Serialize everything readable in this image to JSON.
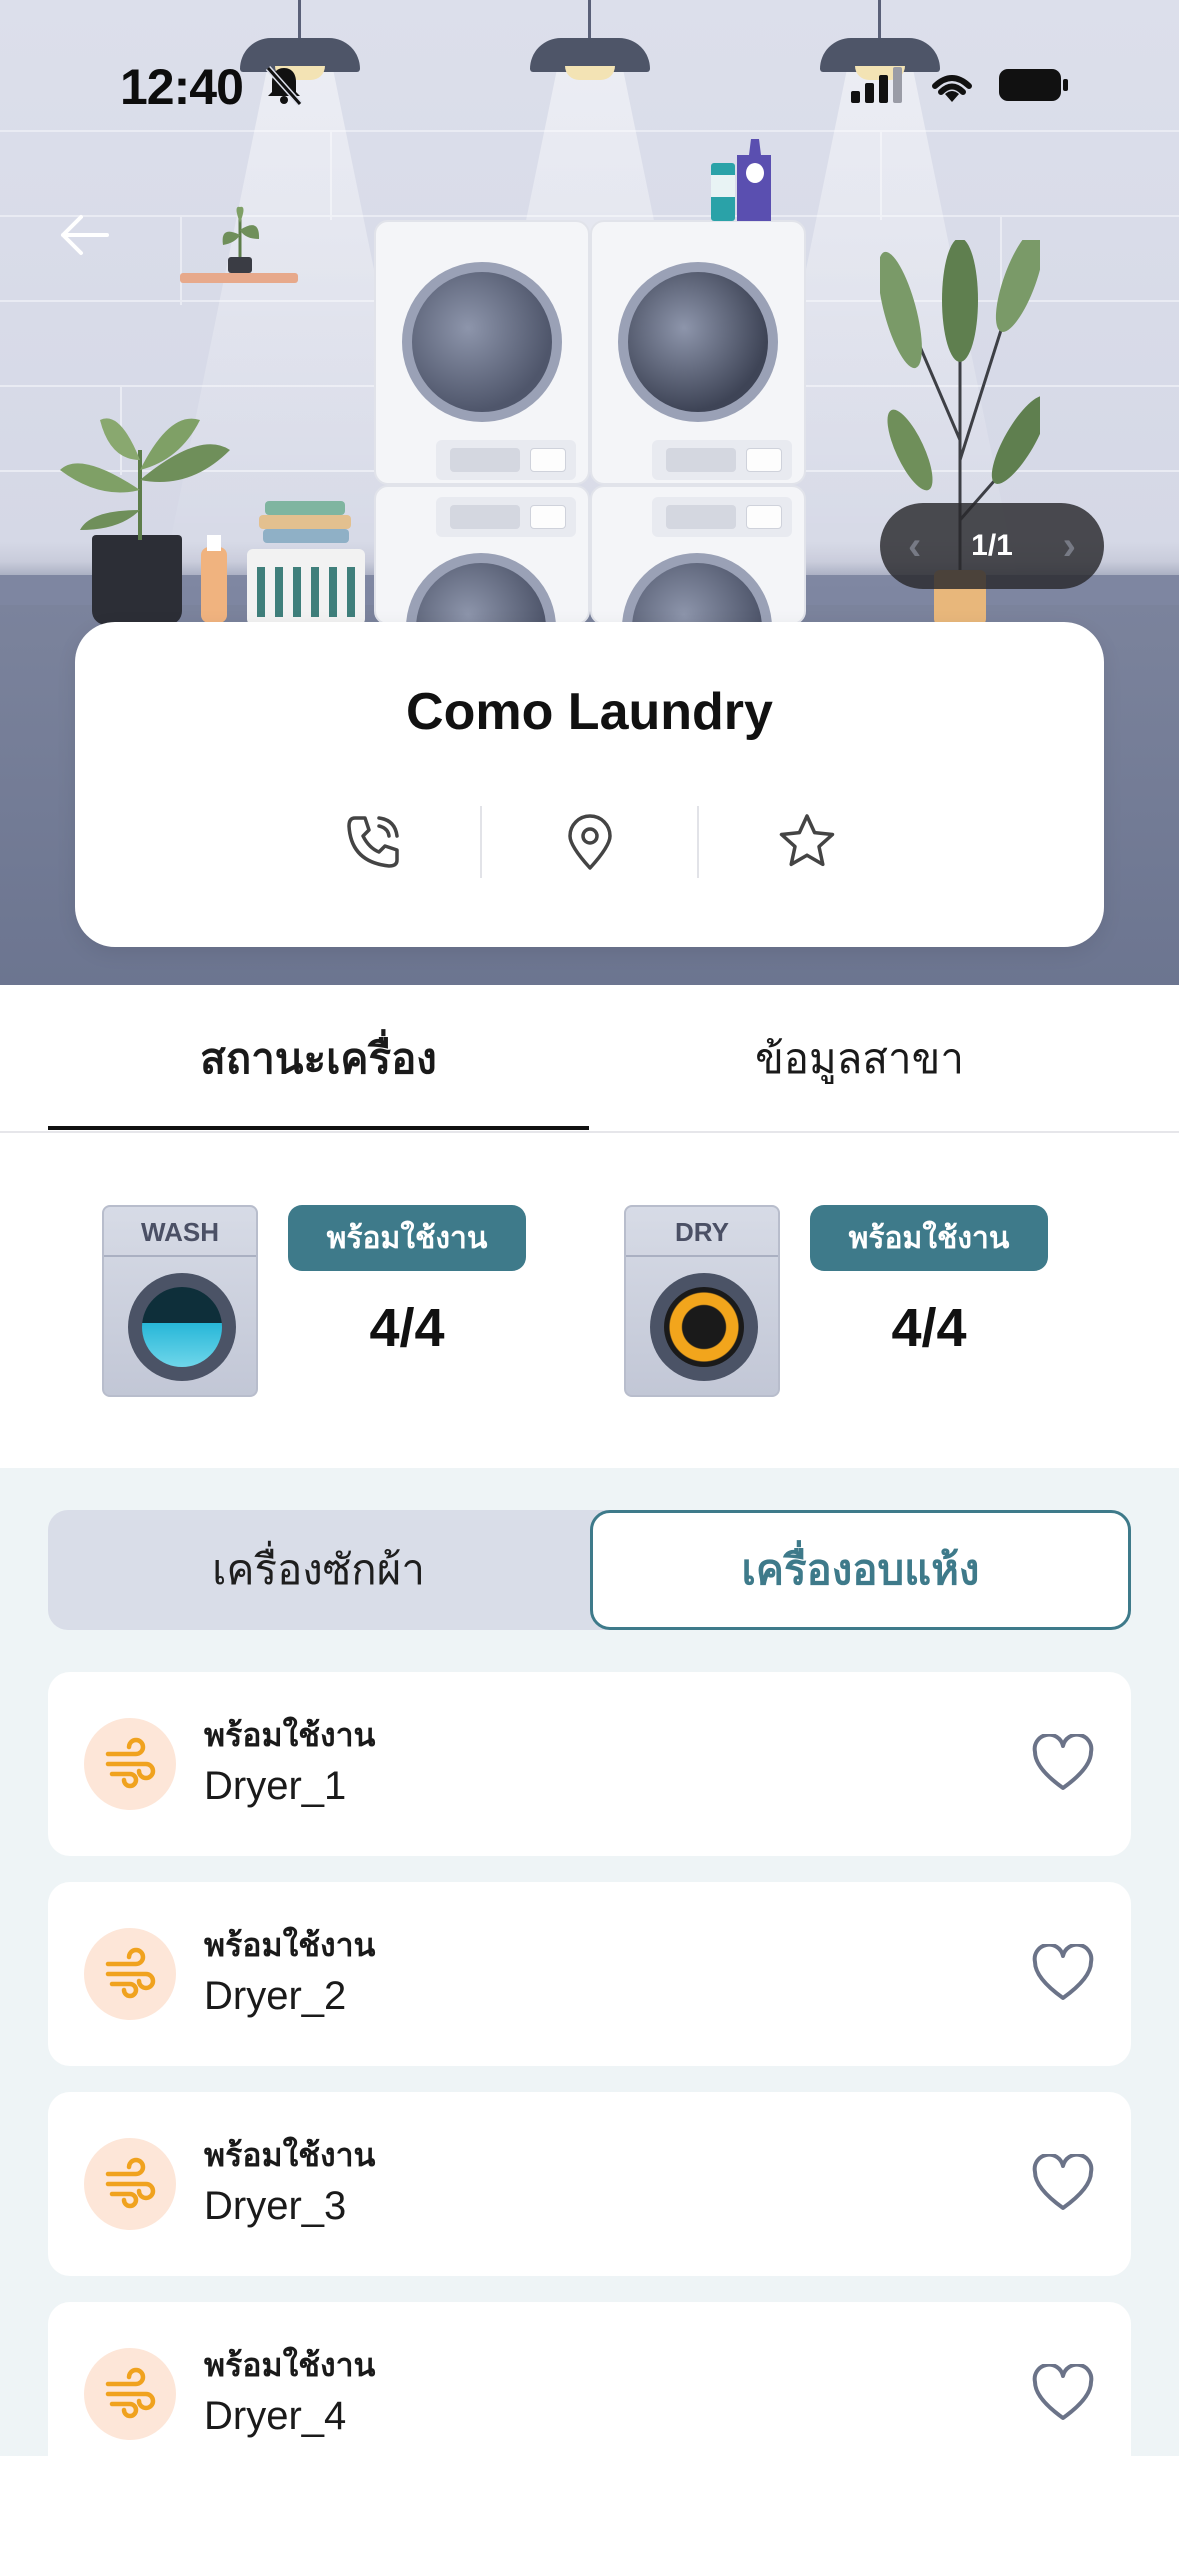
{
  "status_bar": {
    "time": "12:40"
  },
  "hero": {
    "pager": "1/1"
  },
  "branch": {
    "name": "Como Laundry"
  },
  "tabs": [
    {
      "label": "สถานะเครื่อง"
    },
    {
      "label": "ข้อมูลสาขา"
    }
  ],
  "summary": {
    "wash": {
      "tile_label": "WASH",
      "badge": "พร้อมใช้งาน",
      "count": "4/4"
    },
    "dry": {
      "tile_label": "DRY",
      "badge": "พร้อมใช้งาน",
      "count": "4/4"
    }
  },
  "segment": {
    "wash_label": "เครื่องซักผ้า",
    "dry_label": "เครื่องอบแห้ง"
  },
  "machines": [
    {
      "status": "พร้อมใช้งาน",
      "name": "Dryer_1"
    },
    {
      "status": "พร้อมใช้งาน",
      "name": "Dryer_2"
    },
    {
      "status": "พร้อมใช้งาน",
      "name": "Dryer_3"
    },
    {
      "status": "พร้อมใช้งาน",
      "name": "Dryer_4"
    }
  ],
  "colors": {
    "accent": "#3e7a8a",
    "dryer_icon": "#f0a21e",
    "dryer_icon_bg": "#fde6d8",
    "list_bg": "#eef4f6"
  },
  "icons": {
    "back": "arrow-left-icon",
    "phone": "phone-call-icon",
    "location": "map-pin-icon",
    "favorite_branch": "star-icon",
    "machine_type": "wind-icon",
    "favorite_machine": "heart-icon"
  }
}
